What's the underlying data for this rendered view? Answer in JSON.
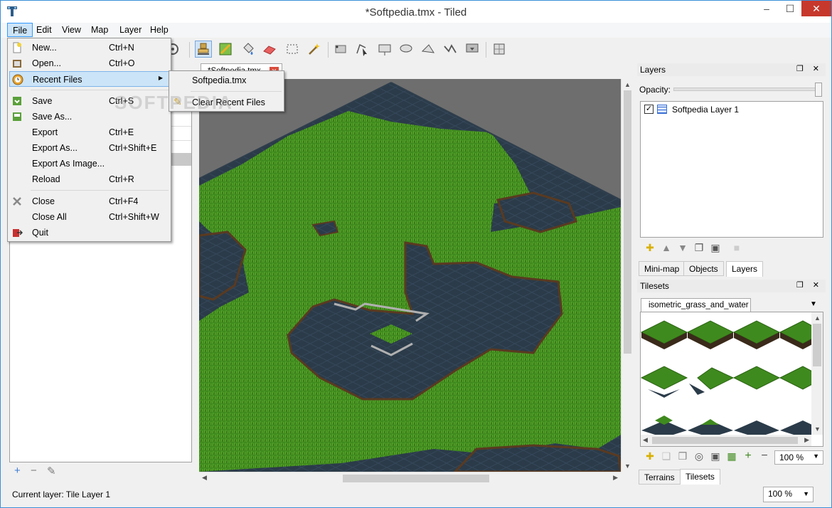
{
  "window": {
    "title": "*Softpedia.tmx - Tiled",
    "min": "–",
    "max": "☐",
    "close": "✕"
  },
  "menubar": [
    "File",
    "Edit",
    "View",
    "Map",
    "Layer",
    "Help"
  ],
  "file_menu": [
    {
      "label": "New...",
      "shortcut": "Ctrl+N",
      "icon": "new-file-icon"
    },
    {
      "label": "Open...",
      "shortcut": "Ctrl+O",
      "icon": "open-icon"
    },
    {
      "label": "Recent Files",
      "shortcut": "",
      "icon": "recent-files-icon",
      "submenu_arrow": "▶"
    },
    {
      "label": "Save",
      "shortcut": "Ctrl+S",
      "icon": "save-icon"
    },
    {
      "label": "Save As...",
      "shortcut": "",
      "icon": "save-as-icon"
    },
    {
      "label": "Export",
      "shortcut": "Ctrl+E"
    },
    {
      "label": "Export As...",
      "shortcut": "Ctrl+Shift+E"
    },
    {
      "label": "Export As Image...",
      "shortcut": ""
    },
    {
      "label": "Reload",
      "shortcut": "Ctrl+R"
    },
    {
      "label": "Close",
      "shortcut": "Ctrl+F4",
      "icon": "close-icon"
    },
    {
      "label": "Close All",
      "shortcut": "Ctrl+Shift+W"
    },
    {
      "label": "Quit",
      "shortcut": "",
      "icon": "quit-icon"
    }
  ],
  "recent_submenu": {
    "file": "Softpedia.tmx",
    "clear": "Clear Recent Files"
  },
  "document_tab": {
    "label": "*Softpedia.tmx",
    "close": "✕"
  },
  "watermark": "SOFTPEDIA",
  "layers_panel": {
    "title": "Layers",
    "opacity_label": "Opacity:",
    "opacity_value": 1.0,
    "layers": [
      {
        "name": "Softpedia Layer 1",
        "visible": true,
        "check": "✓"
      }
    ],
    "tabs": [
      "Mini-map",
      "Objects",
      "Layers"
    ],
    "active_tab": "Layers"
  },
  "tilesets_panel": {
    "title": "Tilesets",
    "tileset_tab": "isometric_grass_and_water",
    "zoom": "100 %",
    "tabs": [
      "Terrains",
      "Tilesets"
    ],
    "active_tab": "Tilesets"
  },
  "left_panel": {
    "buttons": [
      "+",
      "−",
      "✎"
    ]
  },
  "status": {
    "current_layer": "Current layer: Tile Layer 1",
    "zoom": "100 %"
  },
  "dock_buttons": "❐ ✕",
  "colors": {
    "accent": "#cce4f7",
    "grass": "#3f8a1e",
    "water": "#2a3a4a",
    "map_bg": "#6e6e6e"
  }
}
